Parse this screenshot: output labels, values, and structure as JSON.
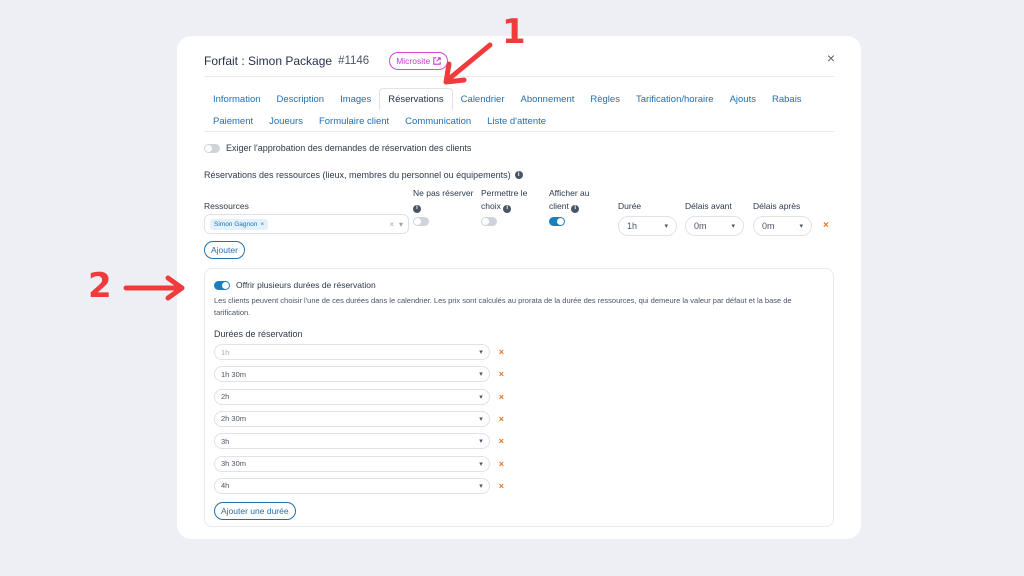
{
  "header": {
    "title": "Forfait : Simon Package",
    "number": "#1146",
    "microsite": "Microsite",
    "close": "×"
  },
  "tabs": {
    "row1": [
      "Information",
      "Description",
      "Images",
      "Réservations",
      "Calendrier",
      "Abonnement",
      "Règles",
      "Tarification/horaire",
      "Ajouts",
      "Rabais"
    ],
    "row2": [
      "Paiement",
      "Joueurs",
      "Formulaire client",
      "Communication",
      "Liste d'attente"
    ],
    "active": "Réservations"
  },
  "approval": {
    "label": "Exiger l'approbation des demandes de réservation des clients",
    "enabled": false
  },
  "resources": {
    "heading": "Réservations des ressources (lieux, membres du personnel ou équipements)",
    "columns": {
      "resources": "Ressources",
      "no_reserve": "Ne pas réserver",
      "allow_choice_1": "Permettre le",
      "allow_choice_2": "choix",
      "show_client_1": "Afficher au",
      "show_client_2": "client",
      "duration": "Durée",
      "delay_before": "Délais avant",
      "delay_after": "Délais après"
    },
    "row": {
      "chip": "Simon Gagnon",
      "no_reserve": false,
      "allow_choice": false,
      "show_client": true,
      "duration": "1h",
      "delay_before": "0m",
      "delay_after": "0m"
    },
    "add_button": "Ajouter"
  },
  "multi_duration": {
    "label": "Offrir plusieurs durées de réservation",
    "enabled": true,
    "description": "Les clients peuvent choisir l'une de ces durées dans le calendrier. Les prix sont calculés au prorata de la durée des ressources, qui demeure la valeur par défaut et la base de tarification.",
    "title": "Durées de réservation",
    "durations": [
      "1h",
      "1h 30m",
      "2h",
      "2h 30m",
      "3h",
      "3h 30m",
      "4h"
    ],
    "add_button": "Ajouter une durée"
  },
  "annotations": {
    "one": "1",
    "two": "2"
  },
  "colors": {
    "accent": "#1f6fb2",
    "remove": "#e8741f",
    "annotation": "#ef3b3b",
    "microsite": "#c838cb"
  },
  "icons": {
    "remove": "×",
    "caret": "▾",
    "external": "external-link-icon"
  }
}
